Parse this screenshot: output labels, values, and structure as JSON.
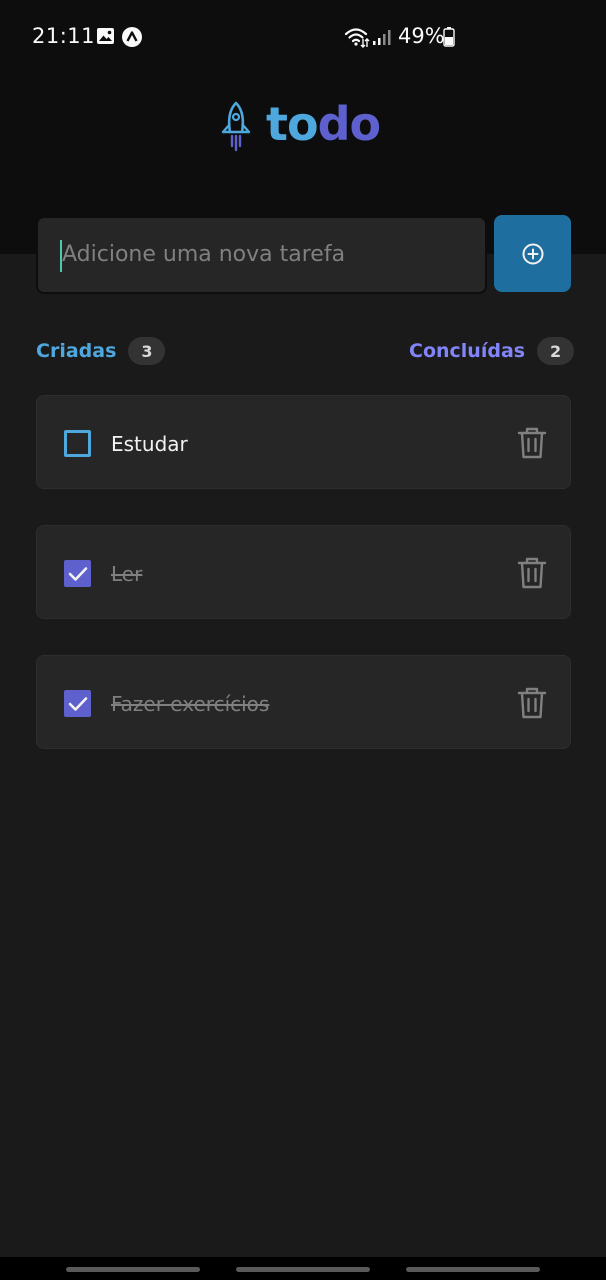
{
  "status_bar": {
    "time": "21:11",
    "battery": "49%",
    "icons": [
      "gallery-icon",
      "app-notification-icon",
      "wifi-icon",
      "signal-icon",
      "battery-icon"
    ]
  },
  "logo": {
    "icon": "rocket-icon",
    "text_part1": "to",
    "text_part2": "do",
    "colors": {
      "part1": "#4ea8de",
      "part2": "#5e60ce"
    }
  },
  "new_task": {
    "placeholder": "Adicione uma nova tarefa",
    "value": "",
    "add_icon": "plus-circle-icon"
  },
  "counters": {
    "created_label": "Criadas",
    "created_count": "3",
    "done_label": "Concluídas",
    "done_count": "2"
  },
  "tasks": [
    {
      "text": "Estudar",
      "done": false
    },
    {
      "text": "Ler",
      "done": true
    },
    {
      "text": "Fazer exercícios",
      "done": true
    }
  ],
  "colors": {
    "background": "#1a1a1a",
    "header": "#0d0d0d",
    "card": "#262626",
    "blue": "#4ea8de",
    "purple": "#5e60ce",
    "button": "#1e6f9f"
  }
}
